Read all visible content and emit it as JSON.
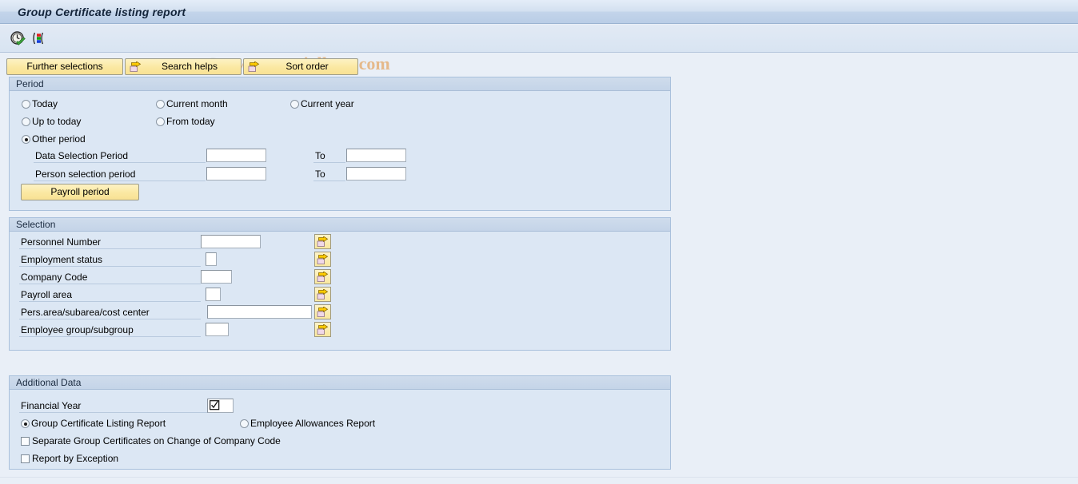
{
  "window": {
    "title": "Group Certificate listing report"
  },
  "toolbar": {
    "execute_icon": "clock-check-icon",
    "variant_icon": "display-variant-icon"
  },
  "watermark": {
    "copyright": "©",
    "text": "www.tutorialkart.com",
    "color": "#e5b98a"
  },
  "buttons": [
    {
      "label": "Further selections",
      "icon": null
    },
    {
      "label": "Search helps",
      "icon": "arrow-folder-icon"
    },
    {
      "label": "Sort order",
      "icon": "arrow-folder-icon"
    }
  ],
  "period": {
    "title": "Period",
    "radios": [
      {
        "label": "Today",
        "selected": false
      },
      {
        "label": "Current month",
        "selected": false
      },
      {
        "label": "Current year",
        "selected": false
      },
      {
        "label": "Up to today",
        "selected": false
      },
      {
        "label": "From today",
        "selected": false
      },
      {
        "label": "Other period",
        "selected": true
      }
    ],
    "rows": [
      {
        "label": "Data Selection Period",
        "value": "",
        "to_label": "To",
        "to_value": ""
      },
      {
        "label": "Person selection period",
        "value": "",
        "to_label": "To",
        "to_value": ""
      }
    ],
    "payroll_button": "Payroll period"
  },
  "selection": {
    "title": "Selection",
    "fields": [
      {
        "label": "Personnel Number",
        "value": ""
      },
      {
        "label": "Employment status",
        "value": ""
      },
      {
        "label": "Company Code",
        "value": ""
      },
      {
        "label": "Payroll area",
        "value": ""
      },
      {
        "label": "Pers.area/subarea/cost center",
        "value": ""
      },
      {
        "label": "Employee group/subgroup",
        "value": ""
      }
    ],
    "multi_select_icon": "arrow-folder-icon"
  },
  "additional": {
    "title": "Additional Data",
    "financial_year_label": "Financial Year",
    "financial_year_value": "",
    "financial_year_icon": "checkbox-checked-icon",
    "report_radios": [
      {
        "label": "Group Certificate Listing Report",
        "selected": true
      },
      {
        "label": "Employee Allowances Report",
        "selected": false
      }
    ],
    "checkboxes": [
      {
        "label": "Separate Group Certificates on Change of Company Code",
        "checked": false
      },
      {
        "label": "Report by Exception",
        "checked": false
      }
    ]
  },
  "colors": {
    "page_bg": "#e9eff7",
    "group_bg": "#dce7f4",
    "group_header": "#c4d4e8",
    "button_yellow": "#fbe9a4",
    "border": "#a9c0dc"
  }
}
